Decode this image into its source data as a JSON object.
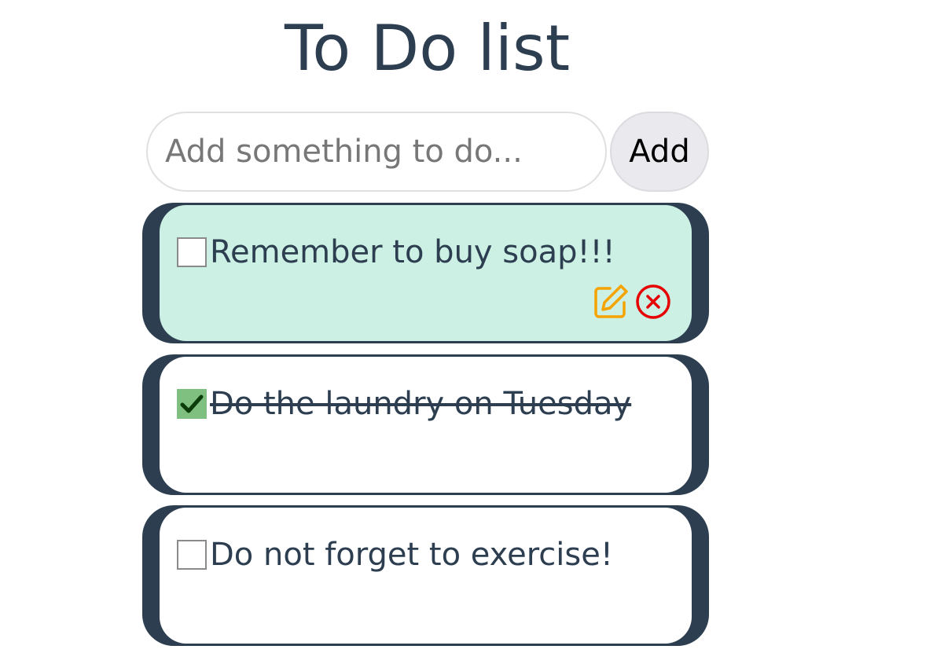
{
  "title": "To Do list",
  "input": {
    "placeholder": "Add something to do...",
    "value": ""
  },
  "add_button_label": "Add",
  "todos": [
    {
      "text": "Remember to buy soap!!!",
      "done": false,
      "active": true
    },
    {
      "text": "Do the laundry on Tuesday",
      "done": true,
      "active": false
    },
    {
      "text": "Do not forget to exercise!",
      "done": false,
      "active": false
    }
  ],
  "icons": {
    "edit": "edit-icon",
    "delete": "delete-icon",
    "check": "checkmark-icon"
  },
  "colors": {
    "text": "#2c3e50",
    "card_border": "#2c3e50",
    "active_card": "#ccf0e4",
    "edit_icon": "#f5a300",
    "delete_icon": "#e60000",
    "checked_box": "#7fbf7f"
  }
}
